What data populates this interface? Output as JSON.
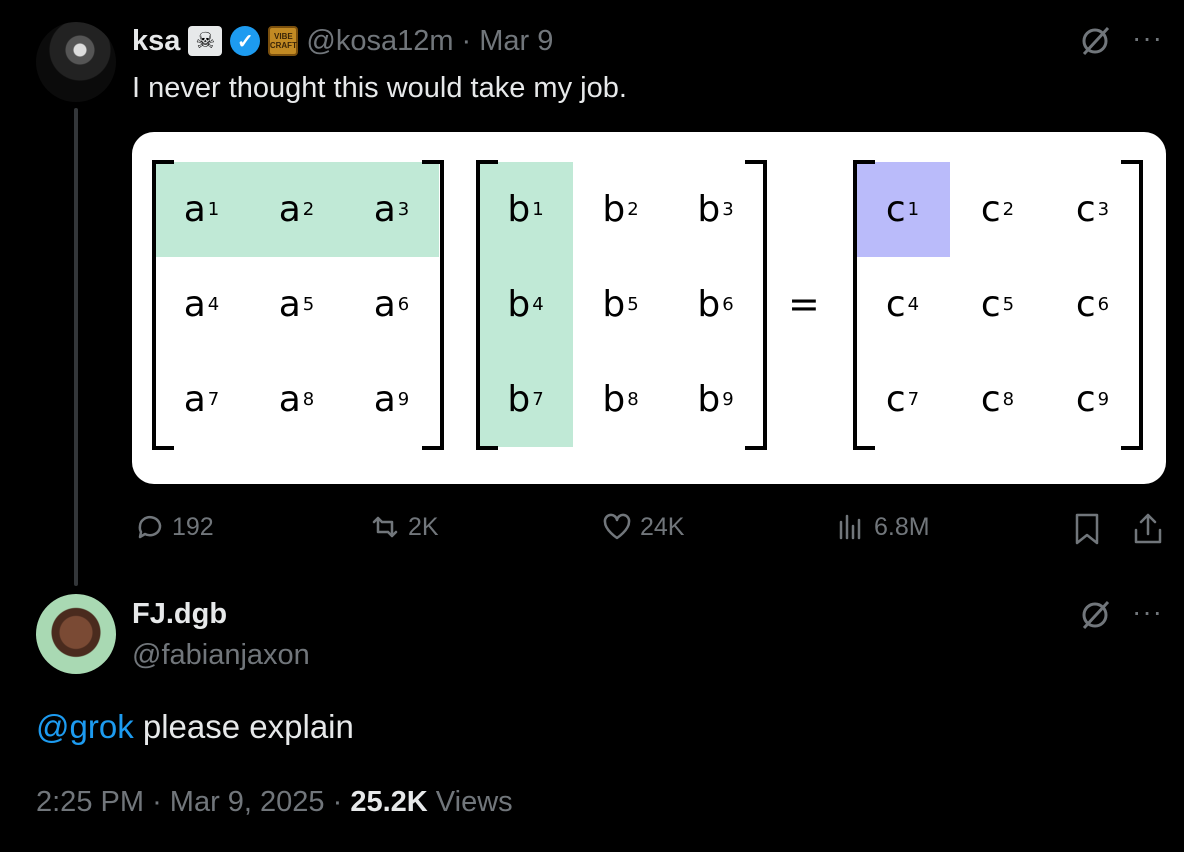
{
  "tweet": {
    "author_name": "ksa",
    "badges": [
      "skull-crossbones-icon",
      "verified-icon",
      "vibe-craft-icon"
    ],
    "vibe_badge_text": "VIBE CRAFT",
    "handle": "@kosa12m",
    "separator": "·",
    "date": "Mar 9",
    "text": "I never thought this would take my job.",
    "matrix": {
      "a": [
        "a",
        "a",
        "a",
        "a",
        "a",
        "a",
        "a",
        "a",
        "a"
      ],
      "b": [
        "b",
        "b",
        "b",
        "b",
        "b",
        "b",
        "b",
        "b",
        "b"
      ],
      "c": [
        "c",
        "c",
        "c",
        "c",
        "c",
        "c",
        "c",
        "c",
        "c"
      ],
      "indices": [
        "1",
        "2",
        "3",
        "4",
        "5",
        "6",
        "7",
        "8",
        "9"
      ],
      "equals": "="
    },
    "actions": {
      "replies": "192",
      "reposts": "2K",
      "likes": "24K",
      "views": "6.8M"
    },
    "colors": {
      "highlight_green": "#c0e9d6",
      "highlight_blue": "#babbfa",
      "link": "#1d9bf0"
    }
  },
  "reply": {
    "author_name": "FJ.dgb",
    "handle": "@fabianjaxon",
    "mention": "@grok",
    "text": " please explain",
    "time": "2:25 PM",
    "separator": "·",
    "date": "Mar 9, 2025",
    "separator2": "·",
    "views_count": "25.2K",
    "views_label": " Views"
  }
}
